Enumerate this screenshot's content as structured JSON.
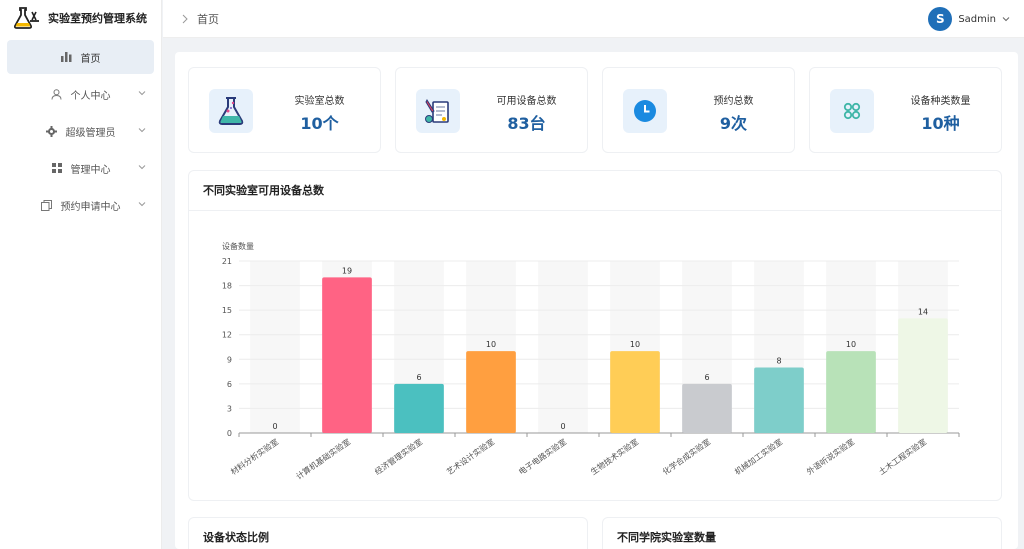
{
  "app": {
    "title": "实验室预约管理系统"
  },
  "sidebar": {
    "items": [
      {
        "label": "首页",
        "icon": "bar-chart-icon",
        "active": true
      },
      {
        "label": "个人中心",
        "icon": "user-icon"
      },
      {
        "label": "超级管理员",
        "icon": "gear-icon"
      },
      {
        "label": "管理中心",
        "icon": "grid-icon"
      },
      {
        "label": "预约申请中心",
        "icon": "copy-icon"
      }
    ]
  },
  "header": {
    "breadcrumb": "首页",
    "user": {
      "initial": "S",
      "name": "Sadmin"
    }
  },
  "stats": [
    {
      "label": "实验室总数",
      "value": "10个",
      "icon": "flask-icon"
    },
    {
      "label": "可用设备总数",
      "value": "83台",
      "icon": "lab-tools-icon"
    },
    {
      "label": "预约总数",
      "value": "9次",
      "icon": "clock-icon"
    },
    {
      "label": "设备种类数量",
      "value": "10种",
      "icon": "nodes-icon"
    }
  ],
  "chart_panel": {
    "title": "不同实验室可用设备总数"
  },
  "chart_data": {
    "type": "bar",
    "ylabel": "设备数量",
    "ylim": [
      0,
      21
    ],
    "yticks": [
      0,
      3,
      6,
      9,
      12,
      15,
      18,
      21
    ],
    "categories": [
      "材料分析实验室",
      "计算机基础实验室",
      "经济管理实验室",
      "艺术设计实验室",
      "电子电路实验室",
      "生物技术实验室",
      "化学合成实验室",
      "机械加工实验室",
      "外语听说实验室",
      "土木工程实验室"
    ],
    "values": [
      0,
      19,
      6,
      10,
      0,
      10,
      6,
      8,
      10,
      14
    ],
    "colors": [
      "#cccccc",
      "#ff6384",
      "#4bc0c0",
      "#ff9f40",
      "#cccccc",
      "#ffcd56",
      "#c9cbcf",
      "#7ececa",
      "#b8e2b8",
      "#eef7e6"
    ],
    "grid": true,
    "legend": "none"
  },
  "bottom": {
    "left_title": "设备状态比例",
    "right_title": "不同学院实验室数量"
  }
}
